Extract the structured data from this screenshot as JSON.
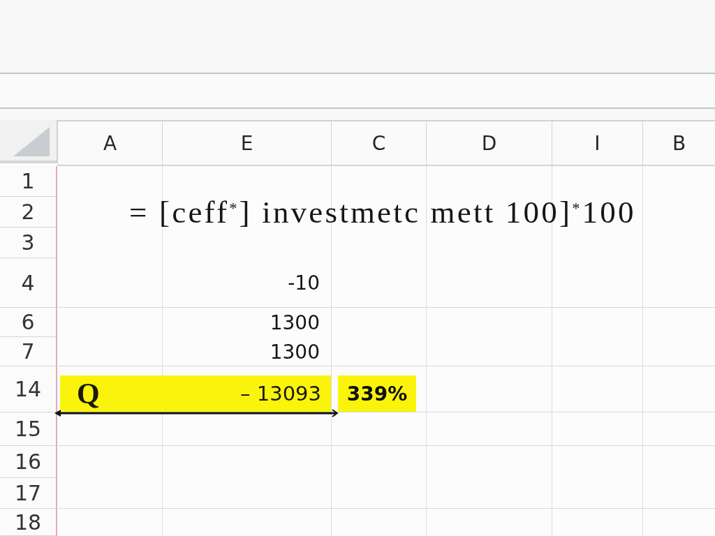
{
  "sheet": {
    "columns": [
      "A",
      "E",
      "C",
      "D",
      "I",
      "B"
    ],
    "rows": [
      {
        "kind": "blank",
        "number": "1"
      },
      {
        "kind": "formula",
        "number": "2",
        "text": "= [ceff$^{*}$] investmetc mett 100]$^{*}$100"
      },
      {
        "kind": "blank",
        "number": "3"
      },
      {
        "kind": "value",
        "number": "4",
        "value": "-10"
      },
      {
        "kind": "value",
        "number": "6",
        "value": "1300"
      },
      {
        "kind": "value",
        "number": "7",
        "value": "1300"
      },
      {
        "kind": "total",
        "number": "14",
        "label": "Q",
        "value": "– 13093",
        "result": "339%"
      },
      {
        "kind": "blank",
        "number": "15"
      },
      {
        "kind": "blank",
        "number": "16"
      },
      {
        "kind": "blank",
        "number": "17"
      },
      {
        "kind": "blank",
        "number": "18"
      }
    ]
  }
}
